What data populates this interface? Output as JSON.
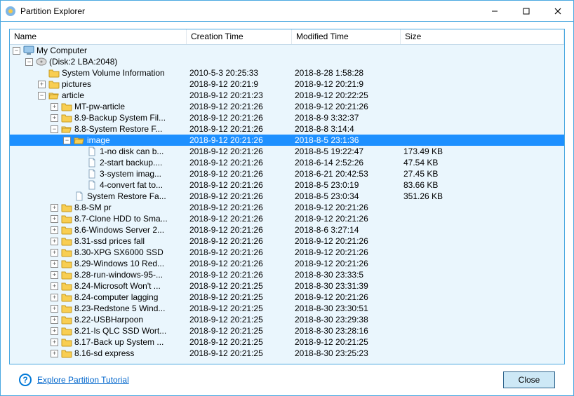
{
  "window": {
    "title": "Partition Explorer"
  },
  "columns": {
    "name": "Name",
    "created": "Creation Time",
    "modified": "Modified Time",
    "size": "Size"
  },
  "footer": {
    "tutorial_link": "Explore Partition Tutorial",
    "close_label": "Close"
  },
  "tree": [
    {
      "depth": 0,
      "toggle": "minus",
      "icon": "computer",
      "name": "My Computer",
      "created": "",
      "modified": "",
      "size": "",
      "selected": false
    },
    {
      "depth": 1,
      "toggle": "minus",
      "icon": "disk",
      "name": "(Disk:2 LBA:2048)",
      "created": "",
      "modified": "",
      "size": "",
      "selected": false
    },
    {
      "depth": 2,
      "toggle": "none",
      "icon": "folder",
      "name": "System Volume Information",
      "created": "2010-5-3 20:25:33",
      "modified": "2018-8-28 1:58:28",
      "size": "",
      "selected": false
    },
    {
      "depth": 2,
      "toggle": "plus",
      "icon": "folder",
      "name": "pictures",
      "created": "2018-9-12 20:21:9",
      "modified": "2018-9-12 20:21:9",
      "size": "",
      "selected": false
    },
    {
      "depth": 2,
      "toggle": "minus",
      "icon": "folder-open",
      "name": "article",
      "created": "2018-9-12 20:21:23",
      "modified": "2018-9-12 20:22:25",
      "size": "",
      "selected": false
    },
    {
      "depth": 3,
      "toggle": "plus",
      "icon": "folder",
      "name": "MT-pw-article",
      "created": "2018-9-12 20:21:26",
      "modified": "2018-9-12 20:21:26",
      "size": "",
      "selected": false
    },
    {
      "depth": 3,
      "toggle": "plus",
      "icon": "folder",
      "name": "8.9-Backup System Fil...",
      "created": "2018-9-12 20:21:26",
      "modified": "2018-8-9 3:32:37",
      "size": "",
      "selected": false
    },
    {
      "depth": 3,
      "toggle": "minus",
      "icon": "folder-open",
      "name": "8.8-System Restore F...",
      "created": "2018-9-12 20:21:26",
      "modified": "2018-8-8 3:14:4",
      "size": "",
      "selected": false
    },
    {
      "depth": 4,
      "toggle": "minus",
      "icon": "folder-open-sel",
      "name": "image",
      "created": "2018-9-12 20:21:26",
      "modified": "2018-8-5 23:1:36",
      "size": "",
      "selected": true
    },
    {
      "depth": 5,
      "toggle": "none",
      "icon": "file",
      "name": "1-no disk can b...",
      "created": "2018-9-12 20:21:26",
      "modified": "2018-8-5 19:22:47",
      "size": "173.49 KB",
      "selected": false
    },
    {
      "depth": 5,
      "toggle": "none",
      "icon": "file",
      "name": "2-start backup....",
      "created": "2018-9-12 20:21:26",
      "modified": "2018-6-14 2:52:26",
      "size": "47.54 KB",
      "selected": false
    },
    {
      "depth": 5,
      "toggle": "none",
      "icon": "file",
      "name": "3-system imag...",
      "created": "2018-9-12 20:21:26",
      "modified": "2018-6-21 20:42:53",
      "size": "27.45 KB",
      "selected": false
    },
    {
      "depth": 5,
      "toggle": "none",
      "icon": "file",
      "name": "4-convert fat to...",
      "created": "2018-9-12 20:21:26",
      "modified": "2018-8-5 23:0:19",
      "size": "83.66 KB",
      "selected": false
    },
    {
      "depth": 4,
      "toggle": "none",
      "icon": "file",
      "name": "System Restore Fa...",
      "created": "2018-9-12 20:21:26",
      "modified": "2018-8-5 23:0:34",
      "size": "351.26 KB",
      "selected": false
    },
    {
      "depth": 3,
      "toggle": "plus",
      "icon": "folder",
      "name": "8.8-SM pr",
      "created": "2018-9-12 20:21:26",
      "modified": "2018-9-12 20:21:26",
      "size": "",
      "selected": false
    },
    {
      "depth": 3,
      "toggle": "plus",
      "icon": "folder",
      "name": "8.7-Clone HDD to Sma...",
      "created": "2018-9-12 20:21:26",
      "modified": "2018-9-12 20:21:26",
      "size": "",
      "selected": false
    },
    {
      "depth": 3,
      "toggle": "plus",
      "icon": "folder",
      "name": "8.6-Windows Server 2...",
      "created": "2018-9-12 20:21:26",
      "modified": "2018-8-6 3:27:14",
      "size": "",
      "selected": false
    },
    {
      "depth": 3,
      "toggle": "plus",
      "icon": "folder",
      "name": "8.31-ssd prices fall",
      "created": "2018-9-12 20:21:26",
      "modified": "2018-9-12 20:21:26",
      "size": "",
      "selected": false
    },
    {
      "depth": 3,
      "toggle": "plus",
      "icon": "folder",
      "name": "8.30-XPG SX6000 SSD",
      "created": "2018-9-12 20:21:26",
      "modified": "2018-9-12 20:21:26",
      "size": "",
      "selected": false
    },
    {
      "depth": 3,
      "toggle": "plus",
      "icon": "folder",
      "name": "8.29-Windows 10 Red...",
      "created": "2018-9-12 20:21:26",
      "modified": "2018-9-12 20:21:26",
      "size": "",
      "selected": false
    },
    {
      "depth": 3,
      "toggle": "plus",
      "icon": "folder",
      "name": "8.28-run-windows-95-...",
      "created": "2018-9-12 20:21:26",
      "modified": "2018-8-30 23:33:5",
      "size": "",
      "selected": false
    },
    {
      "depth": 3,
      "toggle": "plus",
      "icon": "folder",
      "name": "8.24-Microsoft Won't ...",
      "created": "2018-9-12 20:21:25",
      "modified": "2018-8-30 23:31:39",
      "size": "",
      "selected": false
    },
    {
      "depth": 3,
      "toggle": "plus",
      "icon": "folder",
      "name": "8.24-computer lagging",
      "created": "2018-9-12 20:21:25",
      "modified": "2018-9-12 20:21:26",
      "size": "",
      "selected": false
    },
    {
      "depth": 3,
      "toggle": "plus",
      "icon": "folder",
      "name": "8.23-Redstone 5 Wind...",
      "created": "2018-9-12 20:21:25",
      "modified": "2018-8-30 23:30:51",
      "size": "",
      "selected": false
    },
    {
      "depth": 3,
      "toggle": "plus",
      "icon": "folder",
      "name": "8.22-USBHarpoon",
      "created": "2018-9-12 20:21:25",
      "modified": "2018-8-30 23:29:38",
      "size": "",
      "selected": false
    },
    {
      "depth": 3,
      "toggle": "plus",
      "icon": "folder",
      "name": "8.21-Is QLC SSD Wort...",
      "created": "2018-9-12 20:21:25",
      "modified": "2018-8-30 23:28:16",
      "size": "",
      "selected": false
    },
    {
      "depth": 3,
      "toggle": "plus",
      "icon": "folder",
      "name": "8.17-Back up System ...",
      "created": "2018-9-12 20:21:25",
      "modified": "2018-9-12 20:21:25",
      "size": "",
      "selected": false
    },
    {
      "depth": 3,
      "toggle": "plus",
      "icon": "folder",
      "name": "8.16-sd express",
      "created": "2018-9-12 20:21:25",
      "modified": "2018-8-30 23:25:23",
      "size": "",
      "selected": false
    }
  ]
}
